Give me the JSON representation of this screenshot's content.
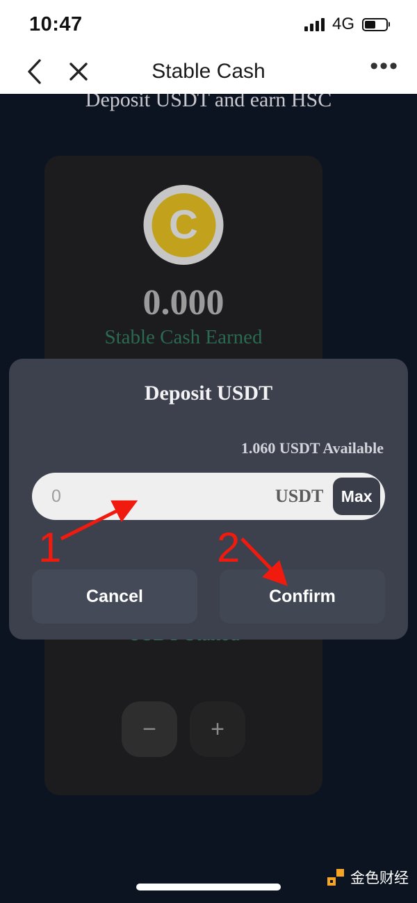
{
  "status_bar": {
    "time": "10:47",
    "network": "4G",
    "signal_icon": "signal-bars-icon",
    "battery_icon": "battery-icon",
    "battery_level": 50
  },
  "nav": {
    "back_icon": "chevron-left-icon",
    "close_icon": "close-icon",
    "title": "Stable Cash",
    "more_icon": "ellipsis-icon",
    "more_label": "•••"
  },
  "page": {
    "subtitle": "Deposit USDT and earn HSC",
    "coin_icon": "stable-cash-coin-icon",
    "coin_letter": "C",
    "earned_value": "0.000",
    "earned_label": "Stable Cash Earned",
    "staked_label": "USDT Staked",
    "stepper": {
      "decrease_label": "−",
      "increase_label": "+"
    }
  },
  "modal": {
    "title": "Deposit USDT",
    "available": "1.060 USDT Available",
    "input_placeholder": "0",
    "input_value": "",
    "unit_label": "USDT",
    "max_label": "Max",
    "cancel_label": "Cancel",
    "confirm_label": "Confirm"
  },
  "annotations": [
    {
      "label": "1",
      "target": "amount-input"
    },
    {
      "label": "2",
      "target": "confirm-button"
    }
  ],
  "watermark": {
    "text": "金色财经",
    "logo_icon": "jinse-logo-icon"
  },
  "colors": {
    "page_background": "#0d1421",
    "card_background": "#1c1c1e",
    "modal_background": "#3d414e",
    "accent_green": "#2b6a51",
    "coin_gold": "#c2a21c",
    "annotation_red": "#f01a0f",
    "watermark_gold": "#f5a623"
  }
}
